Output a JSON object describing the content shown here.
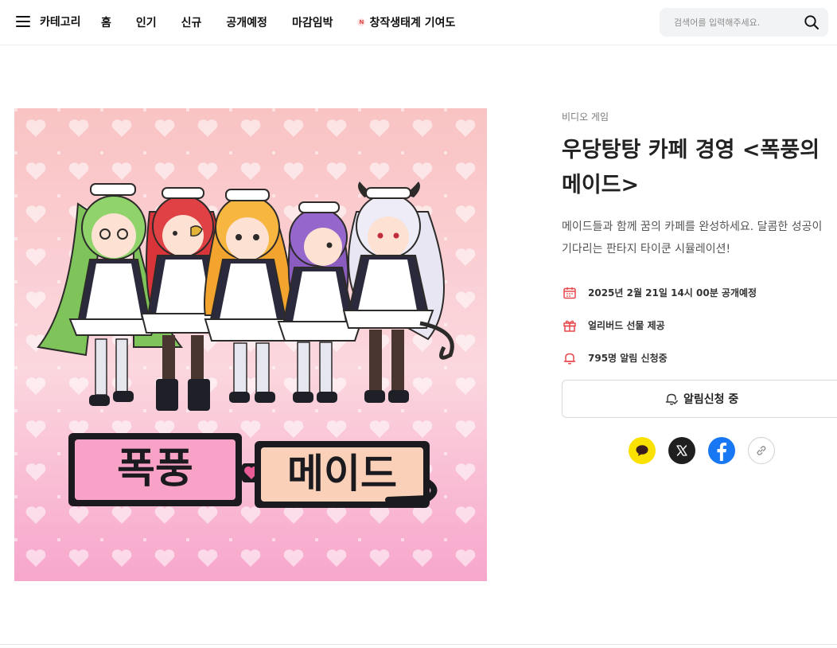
{
  "header": {
    "menu_label": "카테고리",
    "nav": [
      {
        "label": "홈"
      },
      {
        "label": "인기"
      },
      {
        "label": "신규"
      },
      {
        "label": "공개예정"
      },
      {
        "label": "마감임박"
      },
      {
        "label": "창작생태계 기여도",
        "badge": "N"
      }
    ],
    "search_placeholder": "검색어를 입력해주세요."
  },
  "project": {
    "cover_logo_text": "폭풍의 메이드",
    "category": "비디오 게임",
    "title_line1": "우당탕탕 카페 경영 <폭풍의",
    "title_line2": "메이드>",
    "desc_line1": "메이드들과 함께 꿈의 카페를 완성하세요. 달콤한 성공이",
    "desc_line2": "기다리는 판타지 타이쿤 시뮬레이션!",
    "meta": {
      "release": "2025년 2월 21일 14시 00분 공개예정",
      "gift": "얼리버드 선물 제공",
      "alerts": "795명 알림 신청중"
    },
    "notify_label": "알림신청 중"
  },
  "share": [
    "kakao-icon",
    "x-icon",
    "facebook-icon",
    "link-icon"
  ],
  "colors": {
    "accent": "#e5484d",
    "kakao": "#fae100",
    "x": "#1f1f1f",
    "facebook": "#1877f2",
    "cover_top": "#f9c3c3",
    "cover_bottom": "#f7a6cc"
  }
}
